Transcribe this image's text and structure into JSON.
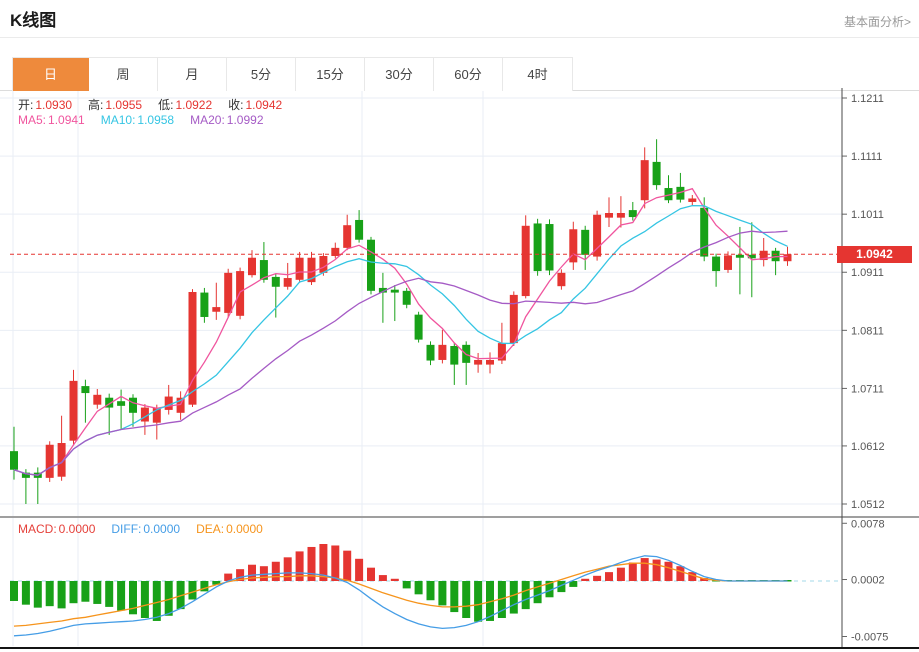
{
  "header": {
    "title": "K线图",
    "link": "基本面分析>"
  },
  "tabs": {
    "items": [
      {
        "label": "日",
        "active": true
      },
      {
        "label": "周",
        "active": false
      },
      {
        "label": "月",
        "active": false
      },
      {
        "label": "5分",
        "active": false
      },
      {
        "label": "15分",
        "active": false
      },
      {
        "label": "30分",
        "active": false
      },
      {
        "label": "60分",
        "active": false
      },
      {
        "label": "4时",
        "active": false
      }
    ]
  },
  "legend": {
    "ohlc": [
      {
        "label": "开:",
        "value": "1.0930"
      },
      {
        "label": "高:",
        "value": "1.0955"
      },
      {
        "label": "低:",
        "value": "1.0922"
      },
      {
        "label": "收:",
        "value": "1.0942"
      }
    ],
    "ma": [
      {
        "label": "MA5:",
        "value": "1.0941",
        "color": "#f0559e"
      },
      {
        "label": "MA10:",
        "value": "1.0958",
        "color": "#35c5e3"
      },
      {
        "label": "MA20:",
        "value": "1.0992",
        "color": "#a55bc5"
      }
    ],
    "macd": [
      {
        "label": "MACD:",
        "value": "0.0000",
        "color": "#e5403a"
      },
      {
        "label": "DIFF:",
        "value": "0.0000",
        "color": "#459de6"
      },
      {
        "label": "DEA:",
        "value": "0.0000",
        "color": "#f6941c"
      }
    ]
  },
  "price_label": "1.0942",
  "colors": {
    "up": "#e53531",
    "down": "#18a118",
    "accent_tab": "#ee8a3c",
    "grid": "#e9eef5",
    "axis_text": "#555",
    "price_line": "#e53531",
    "macd_zero_line": "#a3d9ea"
  },
  "chart_data": [
    {
      "type": "candlestick",
      "title": "K线图",
      "legend_position": "top-left",
      "grid": true,
      "y_axis_side": "right",
      "y_ticks": [
        "1.1211",
        "1.1111",
        "1.1011",
        "1.0911",
        "1.0811",
        "1.0711",
        "1.0612",
        "1.0512"
      ],
      "y_range": [
        1.0512,
        1.1211
      ],
      "price_line": 1.0942,
      "up_color": "#e53531",
      "down_color": "#18a118",
      "ma_overlays": [
        {
          "name": "MA5",
          "period": 5,
          "color": "#f0559e",
          "last_value": 1.0941
        },
        {
          "name": "MA10",
          "period": 10,
          "color": "#35c5e3",
          "last_value": 1.0958
        },
        {
          "name": "MA20",
          "period": 20,
          "color": "#a55bc5",
          "last_value": 1.0992
        }
      ],
      "candles_ohlc": [
        [
          1.0603,
          1.0645,
          1.0554,
          1.0571
        ],
        [
          1.0566,
          1.0572,
          1.0512,
          1.0557
        ],
        [
          1.0566,
          1.0575,
          1.0512,
          1.0557
        ],
        [
          1.0557,
          1.062,
          1.055,
          1.0614
        ],
        [
          1.0559,
          1.0664,
          1.0552,
          1.0617
        ],
        [
          1.0621,
          1.0743,
          1.0614,
          1.0724
        ],
        [
          1.0715,
          1.0726,
          1.0652,
          1.0703
        ],
        [
          1.0683,
          1.071,
          1.0676,
          1.07
        ],
        [
          1.0695,
          1.0702,
          1.0631,
          1.0678
        ],
        [
          1.0689,
          1.0709,
          1.064,
          1.0681
        ],
        [
          1.0695,
          1.0701,
          1.0645,
          1.0669
        ],
        [
          1.0654,
          1.0684,
          1.0631,
          1.0678
        ],
        [
          1.0652,
          1.0683,
          1.0623,
          1.0678
        ],
        [
          1.0674,
          1.0717,
          1.0666,
          1.0697
        ],
        [
          1.0669,
          1.0706,
          1.0657,
          1.0695
        ],
        [
          1.0683,
          1.0882,
          1.0679,
          1.0877
        ],
        [
          1.0876,
          1.0884,
          1.0824,
          1.0834
        ],
        [
          1.0843,
          1.0893,
          1.0829,
          1.0851
        ],
        [
          1.0841,
          1.0917,
          1.0833,
          1.091
        ],
        [
          1.0836,
          1.0919,
          1.083,
          1.0913
        ],
        [
          1.0906,
          1.0949,
          1.0902,
          1.0936
        ],
        [
          1.0932,
          1.0963,
          1.0893,
          1.0898
        ],
        [
          1.0903,
          1.0908,
          1.0833,
          1.0886
        ],
        [
          1.0886,
          1.0927,
          1.0881,
          1.0901
        ],
        [
          1.0898,
          1.0946,
          1.0893,
          1.0936
        ],
        [
          1.0894,
          1.0946,
          1.0889,
          1.0936
        ],
        [
          1.091,
          1.0944,
          1.0905,
          1.0939
        ],
        [
          1.0939,
          1.0962,
          1.0935,
          1.0953
        ],
        [
          1.0953,
          1.101,
          1.0949,
          1.0992
        ],
        [
          1.1001,
          1.1018,
          1.0962,
          1.0967
        ],
        [
          1.0967,
          1.0972,
          1.0873,
          1.0879
        ],
        [
          1.0884,
          1.091,
          1.0824,
          1.0876
        ],
        [
          1.0881,
          1.0889,
          1.0827,
          1.0876
        ],
        [
          1.0879,
          1.0884,
          1.0849,
          1.0855
        ],
        [
          1.0838,
          1.0843,
          1.079,
          1.0795
        ],
        [
          1.0786,
          1.0792,
          1.0751,
          1.0759
        ],
        [
          1.076,
          1.0812,
          1.0754,
          1.0786
        ],
        [
          1.0784,
          1.079,
          1.0717,
          1.0752
        ],
        [
          1.0786,
          1.0792,
          1.0717,
          1.0755
        ],
        [
          1.0752,
          1.0772,
          1.0738,
          1.076
        ],
        [
          1.0752,
          1.0773,
          1.0737,
          1.076
        ],
        [
          1.0759,
          1.0824,
          1.0753,
          1.0789
        ],
        [
          1.0789,
          1.0878,
          1.0784,
          1.0872
        ],
        [
          1.087,
          1.1009,
          1.0866,
          1.0991
        ],
        [
          1.0995,
          1.1003,
          1.0905,
          1.0913
        ],
        [
          1.0994,
          1.1002,
          1.0906,
          1.0914
        ],
        [
          1.0887,
          1.0916,
          1.0881,
          1.091
        ],
        [
          1.0928,
          1.0998,
          1.0915,
          1.0985
        ],
        [
          1.0984,
          1.0991,
          1.0915,
          1.0941
        ],
        [
          1.0938,
          1.1017,
          1.0931,
          1.101
        ],
        [
          1.1005,
          1.104,
          1.0989,
          1.1013
        ],
        [
          1.1005,
          1.1042,
          1.0988,
          1.1013
        ],
        [
          1.1018,
          1.1032,
          1.1,
          1.1006
        ],
        [
          1.1035,
          1.1126,
          1.1021,
          1.1104
        ],
        [
          1.1101,
          1.114,
          1.1053,
          1.1061
        ],
        [
          1.1056,
          1.1078,
          1.103,
          1.1035
        ],
        [
          1.1058,
          1.1082,
          1.1031,
          1.1036
        ],
        [
          1.1032,
          1.1044,
          1.1026,
          1.1038
        ],
        [
          1.1022,
          1.104,
          1.093,
          1.0938
        ],
        [
          1.0938,
          1.0943,
          1.0886,
          1.0913
        ],
        [
          1.0915,
          1.0947,
          1.091,
          1.094
        ],
        [
          1.0941,
          1.0989,
          1.0873,
          1.0936
        ],
        [
          1.0941,
          1.0997,
          1.0868,
          1.0935
        ],
        [
          1.0932,
          1.097,
          1.0921,
          1.0948
        ],
        [
          1.0948,
          1.0953,
          1.0906,
          1.093
        ],
        [
          1.093,
          1.0955,
          1.0922,
          1.0942
        ]
      ],
      "last_candle": {
        "open": 1.093,
        "high": 1.0955,
        "low": 1.0922,
        "close": 1.0942
      }
    },
    {
      "type": "macd",
      "y_ticks": [
        "0.0078",
        "0.0002",
        "-0.0075"
      ],
      "y_tick_values": [
        0.0078,
        0.0002,
        -0.0075
      ],
      "hist_up_color": "#e53531",
      "hist_down_color": "#18a118",
      "diff_color": "#459de6",
      "dea_color": "#f6941c",
      "hist": [
        -0.0027,
        -0.0032,
        -0.0036,
        -0.0034,
        -0.0037,
        -0.003,
        -0.0028,
        -0.0031,
        -0.0035,
        -0.004,
        -0.0045,
        -0.005,
        -0.0054,
        -0.0047,
        -0.0038,
        -0.0025,
        -0.0014,
        -0.0005,
        0.001,
        0.0016,
        0.0022,
        0.002,
        0.0026,
        0.0032,
        0.004,
        0.0046,
        0.005,
        0.0048,
        0.0041,
        0.003,
        0.0018,
        0.0008,
        0.0003,
        -0.001,
        -0.0018,
        -0.0026,
        -0.0033,
        -0.0042,
        -0.005,
        -0.0055,
        -0.0054,
        -0.005,
        -0.0044,
        -0.0038,
        -0.003,
        -0.0022,
        -0.0015,
        -0.0008,
        0.0003,
        0.0007,
        0.0012,
        0.0018,
        0.0025,
        0.0031,
        0.0029,
        0.0026,
        0.002,
        0.0012,
        0.0004,
        0.0,
        0.0,
        0.0,
        0.0,
        0.0,
        0.0,
        0.0
      ],
      "diff": [
        -0.0074,
        -0.0073,
        -0.0071,
        -0.0068,
        -0.0064,
        -0.006,
        -0.0058,
        -0.0057,
        -0.0056,
        -0.0055,
        -0.0054,
        -0.0052,
        -0.0049,
        -0.0044,
        -0.0037,
        -0.0028,
        -0.0018,
        -0.0008,
        0.0,
        0.0005,
        0.0008,
        0.0009,
        0.001,
        0.0011,
        0.0011,
        0.001,
        0.0008,
        0.0004,
        -0.0002,
        -0.0012,
        -0.0024,
        -0.0035,
        -0.0044,
        -0.0052,
        -0.0058,
        -0.0062,
        -0.0064,
        -0.0063,
        -0.006,
        -0.0055,
        -0.0048,
        -0.004,
        -0.0032,
        -0.0025,
        -0.0019,
        -0.0013,
        -0.0006,
        0.0001,
        0.0008,
        0.0014,
        0.0019,
        0.0025,
        0.003,
        0.0034,
        0.0033,
        0.0028,
        0.0021,
        0.0013,
        0.0006,
        0.0002,
        0.0,
        0.0,
        0.0,
        0.0,
        0.0,
        0.0
      ],
      "dea": [
        -0.0061,
        -0.006,
        -0.0058,
        -0.0056,
        -0.0054,
        -0.0051,
        -0.0049,
        -0.0046,
        -0.0043,
        -0.004,
        -0.0037,
        -0.0033,
        -0.0029,
        -0.0025,
        -0.002,
        -0.0015,
        -0.001,
        -0.0005,
        -0.0001,
        0.0002,
        0.0004,
        0.0005,
        0.0006,
        0.0006,
        0.0007,
        0.0007,
        0.0006,
        0.0004,
        0.0001,
        -0.0004,
        -0.001,
        -0.0016,
        -0.0021,
        -0.0026,
        -0.003,
        -0.0033,
        -0.0035,
        -0.0035,
        -0.0034,
        -0.0032,
        -0.0028,
        -0.0024,
        -0.0019,
        -0.0013,
        -0.0008,
        -0.0003,
        0.0002,
        0.0007,
        0.0012,
        0.0016,
        0.002,
        0.0022,
        0.0024,
        0.0024,
        0.0022,
        0.0018,
        0.0013,
        0.0008,
        0.0003,
        0.0001,
        0.0,
        0.0,
        0.0,
        0.0,
        0.0,
        0.0
      ]
    }
  ]
}
